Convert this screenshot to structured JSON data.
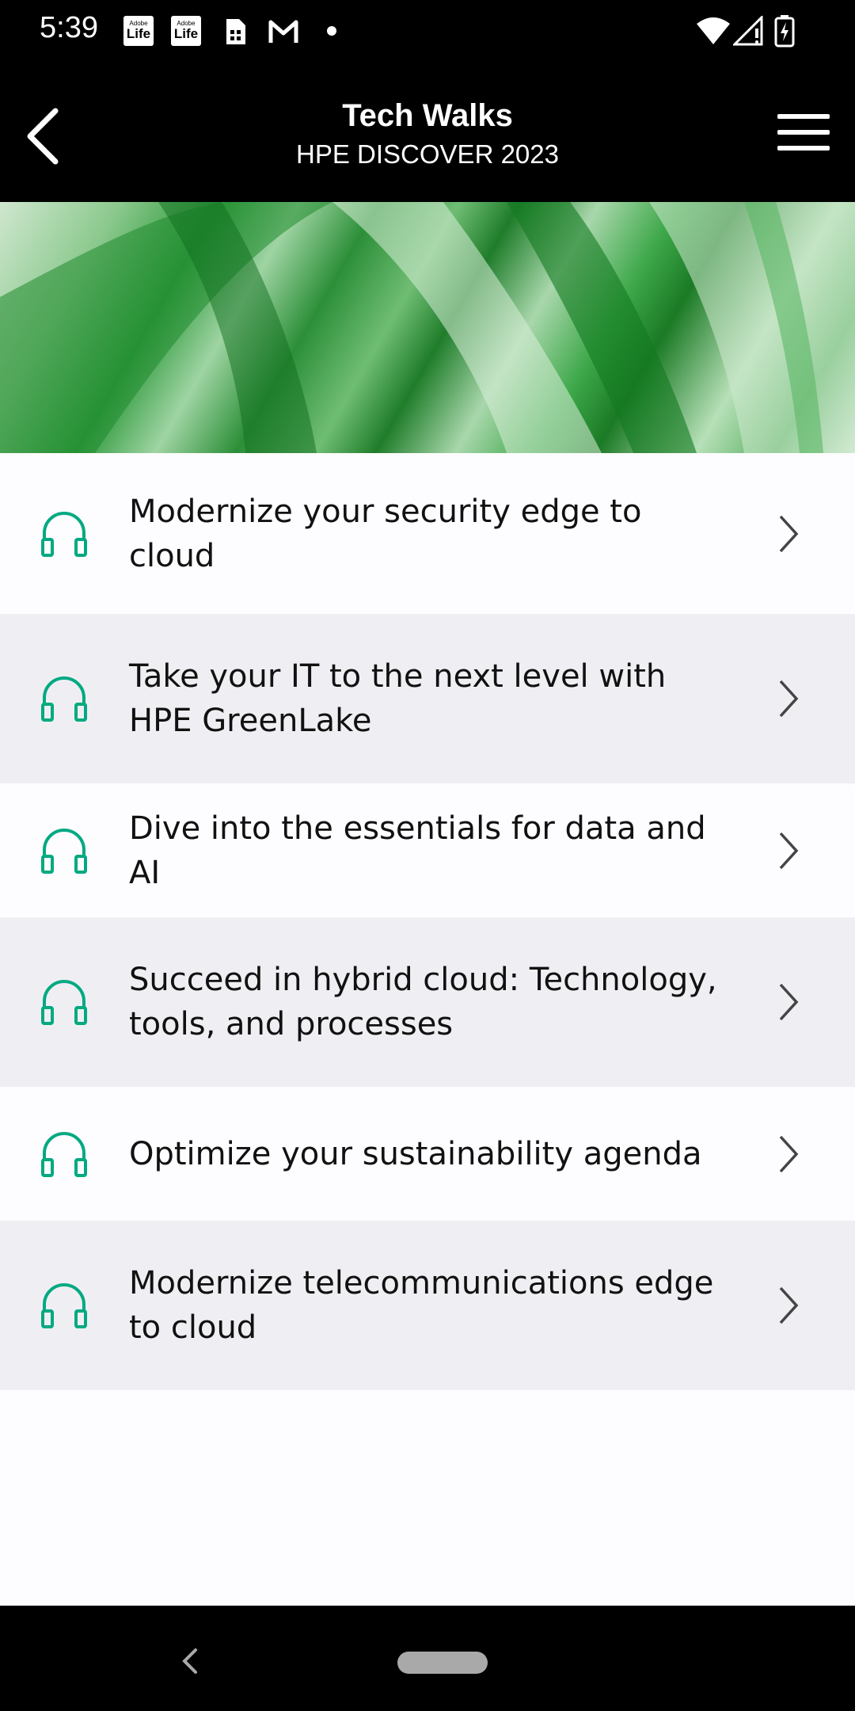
{
  "status": {
    "time": "5:39",
    "badge_small": "Adobe",
    "badge_big": "Life"
  },
  "header": {
    "title": "Tech Walks",
    "subtitle": "HPE DISCOVER 2023"
  },
  "items": [
    {
      "label": "Modernize your security edge to cloud"
    },
    {
      "label": "Take your IT to the next level with HPE GreenLake"
    },
    {
      "label": "Dive into the essentials for data and AI"
    },
    {
      "label": "Succeed in hybrid cloud: Technology, tools, and processes"
    },
    {
      "label": "Optimize your sustainability agenda"
    },
    {
      "label": "Modernize telecommunications edge to cloud"
    }
  ],
  "colors": {
    "accent": "#01a982",
    "row_alt": "#efeff3"
  },
  "icons": {
    "list_item": "headphones-icon",
    "list_chevron": "chevron-right-icon"
  }
}
